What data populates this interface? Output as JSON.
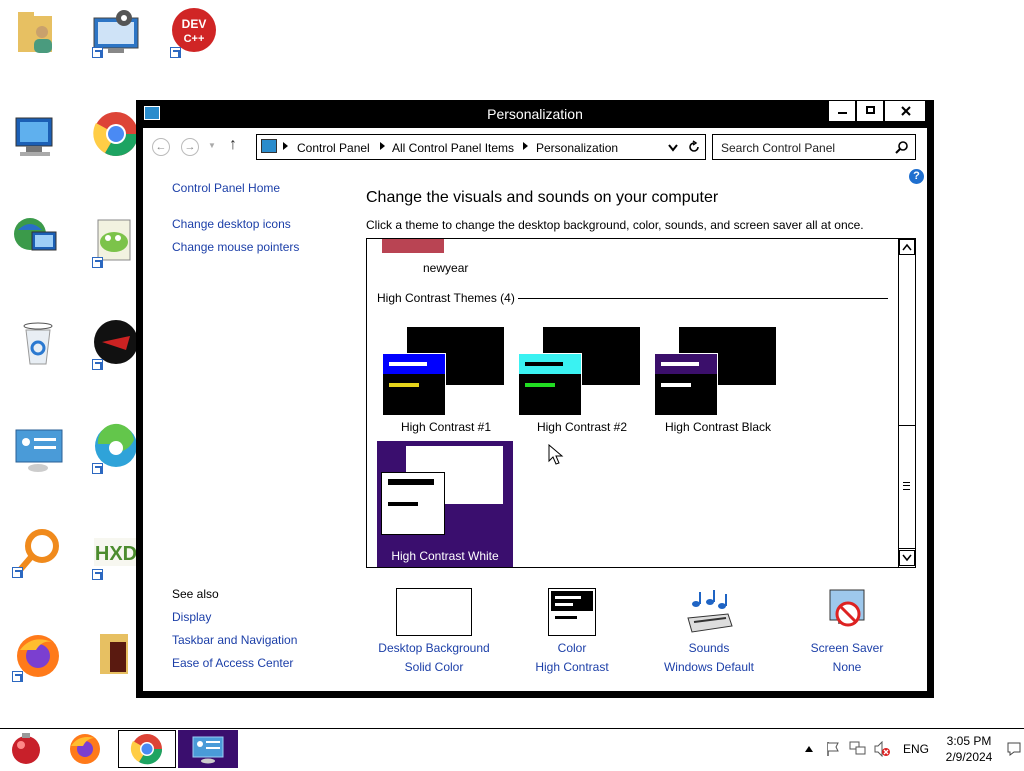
{
  "window": {
    "title": "Personalization",
    "minimize_label": "—",
    "maximize_label": "□",
    "close_label": "✕"
  },
  "nav": {
    "breadcrumbs": [
      "Control Panel",
      "All Control Panel Items",
      "Personalization"
    ],
    "search_placeholder": "Search Control Panel"
  },
  "sidebar": {
    "home": "Control Panel Home",
    "items": [
      "Change desktop icons",
      "Change mouse pointers"
    ],
    "see_also_title": "See also",
    "see_also": [
      "Display",
      "Taskbar and Navigation",
      "Ease of Access Center"
    ]
  },
  "main": {
    "heading": "Change the visuals and sounds on your computer",
    "subheading": "Click a theme to change the desktop background, color, sounds, and screen saver all at once."
  },
  "themes": {
    "previous_theme_label": "newyear",
    "section_title": "High Contrast Themes (4)",
    "items": [
      {
        "label": "High Contrast #1",
        "accent": "#0000ff",
        "text_line": "#e5d31b"
      },
      {
        "label": "High Contrast #2",
        "accent": "#3af2f2",
        "text_line": "#22dd22"
      },
      {
        "label": "High Contrast Black",
        "accent": "#3b0f6b",
        "text_line": "#ffffff"
      },
      {
        "label": "High Contrast White",
        "accent": "#ffffff",
        "text_line": "#000000",
        "selected": true
      }
    ],
    "selected_bg": "#3a0e6e"
  },
  "settings": [
    {
      "caption": "Desktop Background",
      "value": "Solid Color"
    },
    {
      "caption": "Color",
      "value": "High Contrast"
    },
    {
      "caption": "Sounds",
      "value": "Windows Default"
    },
    {
      "caption": "Screen Saver",
      "value": "None"
    }
  ],
  "desktop_icons": [
    "user-folder-icon",
    "control-panel-icon",
    "dev-cpp-icon",
    "this-pc-icon",
    "chrome-icon",
    "network-icon",
    "notepad-plus-plus-icon",
    "recycle-bin-icon",
    "red-app-icon",
    "control-panel-2-icon",
    "edge-icon",
    "search-tool-icon",
    "hxd-icon",
    "firefox-icon",
    "app-folder-icon"
  ],
  "desktop_labels": {
    "dev": "DEV",
    "cpp": "C++",
    "hxd": "HXD"
  },
  "taskbar": {
    "language": "ENG",
    "time": "3:05 PM",
    "date": "2/9/2024"
  }
}
